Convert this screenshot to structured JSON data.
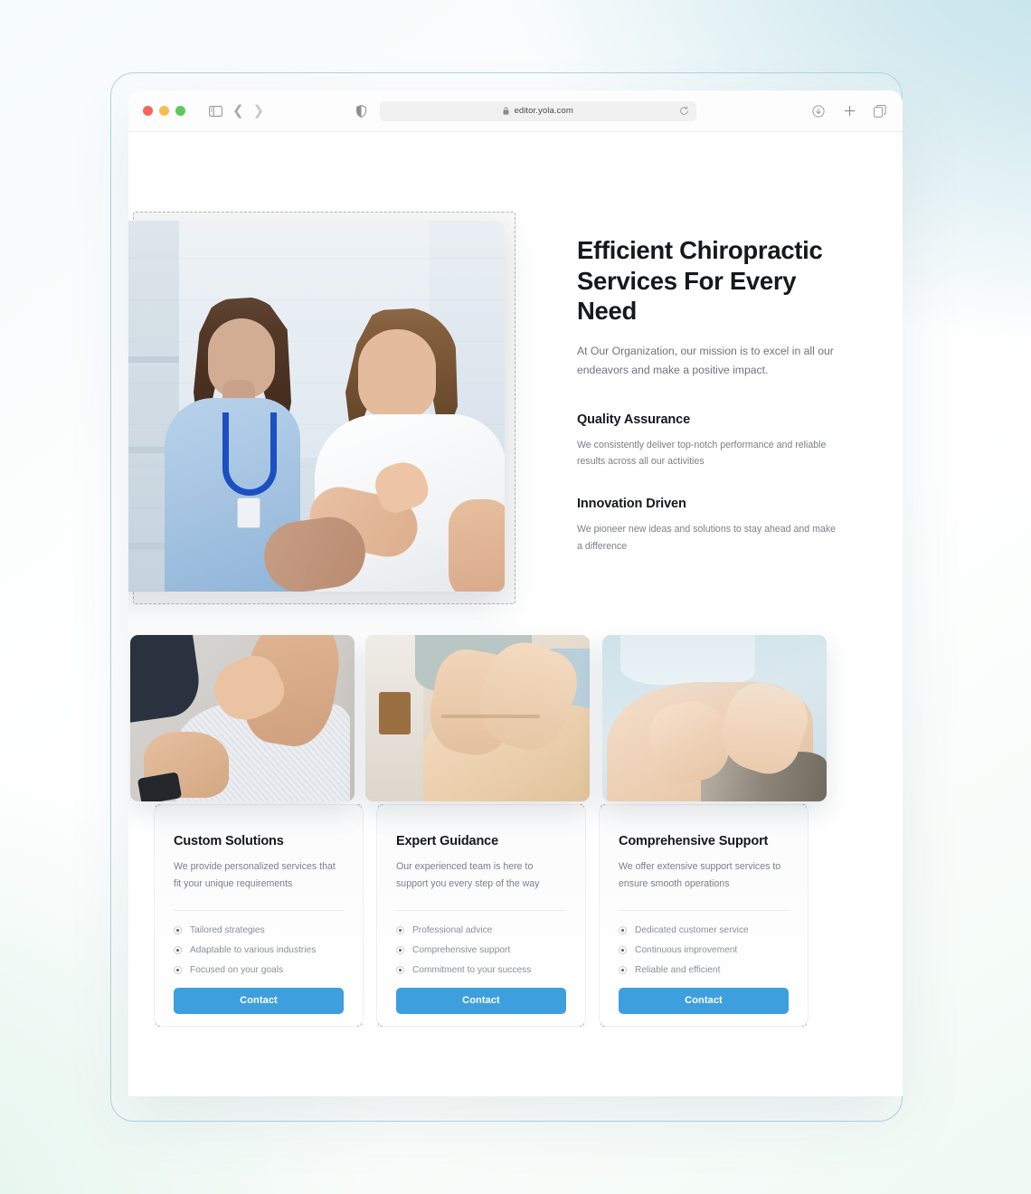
{
  "browser": {
    "url": "editor.yola.com",
    "icons": {
      "sidebar": "sidebar-toggle-icon",
      "back": "back-chevron-icon",
      "forward": "forward-chevron-icon",
      "shield": "privacy-shield-icon",
      "lock": "lock-icon",
      "reload": "reload-icon",
      "download": "download-icon",
      "new_tab": "plus-icon",
      "tabs": "tab-overview-icon"
    },
    "traffic_lights": {
      "close": "#f5655b",
      "minimize": "#f7bd4f",
      "maximize": "#5cc95c"
    }
  },
  "hero": {
    "image_alt": "chiropractor-examining-patient-neck-pain",
    "title": "Efficient Chiropractic Services For Every Need",
    "subtitle": "At Our Organization, our mission is to excel in all our endeavors and make a positive impact.",
    "features": [
      {
        "title": "Quality Assurance",
        "body": "We consistently deliver top-notch performance and reliable results across all our activities"
      },
      {
        "title": "Innovation Driven",
        "body": "We pioneer new ideas and solutions to stay ahead and make a difference"
      }
    ]
  },
  "cards": [
    {
      "image_alt": "therapist-adjusting-patient-shoulder",
      "title": "Custom Solutions",
      "description": "We provide personalized services that fit your unique requirements",
      "items": [
        "Tailored strategies",
        "Adaptable to various industries",
        "Focused on your goals"
      ],
      "button": "Contact"
    },
    {
      "image_alt": "hands-performing-back-massage",
      "title": "Expert Guidance",
      "description": "Our experienced team is here to support you every step of the way",
      "items": [
        "Professional advice",
        "Comprehensive support",
        "Commitment to your success"
      ],
      "button": "Contact"
    },
    {
      "image_alt": "shoulder-massage-treatment-session",
      "title": "Comprehensive Support",
      "description": "We offer extensive support services to ensure smooth operations",
      "items": [
        "Dedicated customer service",
        "Continuous improvement",
        "Reliable and efficient"
      ],
      "button": "Contact"
    }
  ],
  "theme": {
    "accent": "#3d9fdd",
    "heading_color": "#16181c",
    "body_color": "#7b8084",
    "frame_border": "#aed4e6",
    "selection_dash": "#b4b4b4",
    "backdrop_top_right": "#cde7ec",
    "backdrop_bottom_left": "#eff8f5"
  }
}
